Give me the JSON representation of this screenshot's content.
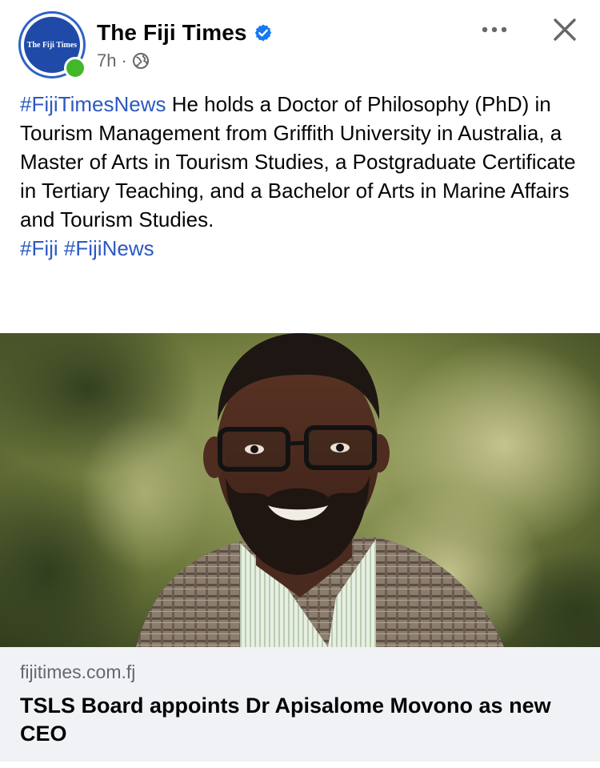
{
  "post": {
    "page_name": "The Fiji Times",
    "avatar_text": "The Fiji Times",
    "time": "7h",
    "meta_separator": "·",
    "text_hashtag_lead": "#FijiTimesNews",
    "text_body": " He holds a Doctor of Philosophy (PhD) in Tourism Management from Griffith University in Australia, a Master of Arts in Tourism Studies, a Postgraduate Certificate in Tertiary Teaching, and a Bachelor of Arts in Marine Affairs and Tourism Studies.",
    "hashtags": [
      "#Fiji",
      "#FijiNews"
    ]
  },
  "link_preview": {
    "domain": "fijitimes.com.fj",
    "title": "TSLS Board appoints Dr Apisalome Movono as new CEO"
  },
  "icons": {
    "verified": "verified-badge-icon",
    "audience": "globe-icon",
    "more": "more-options-icon",
    "close": "close-icon"
  },
  "colors": {
    "hashtag": "#2b59c3",
    "verified": "#1877f2",
    "online": "#42b72a",
    "preview_bg": "#f0f2f5",
    "secondary_text": "#65676b"
  }
}
